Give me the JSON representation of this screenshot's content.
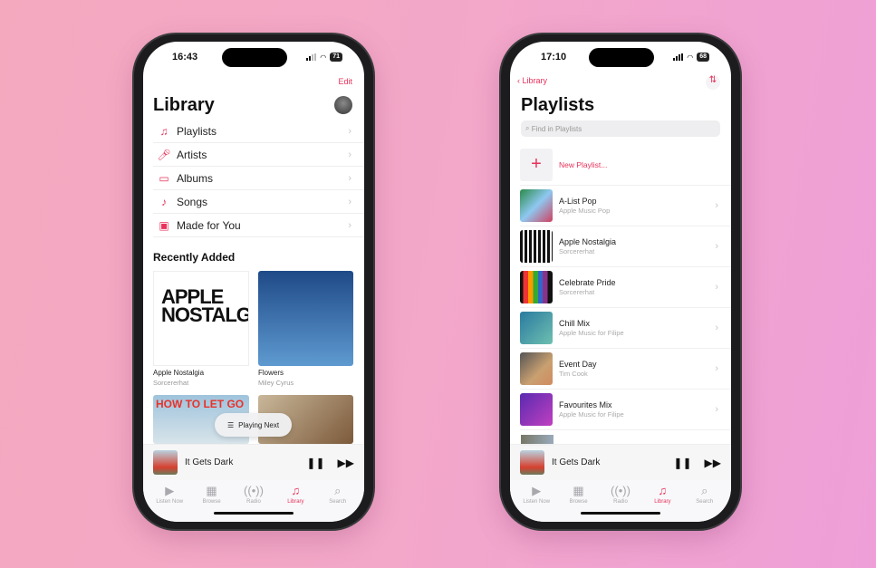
{
  "colors": {
    "accent": "#e8325a",
    "background_left": "#f5a9bf",
    "background_right": "#ee9fd8"
  },
  "left_phone": {
    "status": {
      "time": "16:43",
      "battery": "71"
    },
    "edit_label": "Edit",
    "title": "Library",
    "menu": [
      {
        "label": "Playlists",
        "icon": "playlist-icon"
      },
      {
        "label": "Artists",
        "icon": "microphone-icon"
      },
      {
        "label": "Albums",
        "icon": "album-stack-icon"
      },
      {
        "label": "Songs",
        "icon": "music-note-icon"
      },
      {
        "label": "Made for You",
        "icon": "person-square-icon"
      }
    ],
    "recently_added_heading": "Recently Added",
    "albums": [
      {
        "title": "Apple Nostalgia",
        "subtitle": "Sorcererhat",
        "art_text": "APPLE NOSTALGIA"
      },
      {
        "title": "Flowers",
        "subtitle": "Miley Cyrus"
      }
    ],
    "row2_art_text": "HOW TO LET GO",
    "playing_next": "Playing Next",
    "now_playing": "It Gets Dark"
  },
  "right_phone": {
    "status": {
      "time": "17:10",
      "battery": "68"
    },
    "back_label": "Library",
    "title": "Playlists",
    "search_placeholder": "Find in Playlists",
    "new_playlist": "New Playlist...",
    "playlists": [
      {
        "name": "A-List Pop",
        "subtitle": "Apple Music Pop"
      },
      {
        "name": "Apple Nostalgia",
        "subtitle": "Sorcererhat"
      },
      {
        "name": "Celebrate Pride",
        "subtitle": "Sorcererhat"
      },
      {
        "name": "Chill Mix",
        "subtitle": "Apple Music for Filipe"
      },
      {
        "name": "Event Day",
        "subtitle": "Tim Cook"
      },
      {
        "name": "Favourites Mix",
        "subtitle": "Apple Music for Filipe"
      }
    ],
    "now_playing": "It Gets Dark"
  },
  "tabs": [
    "Listen Now",
    "Browse",
    "Radio",
    "Library",
    "Search"
  ],
  "active_tab": "Library"
}
